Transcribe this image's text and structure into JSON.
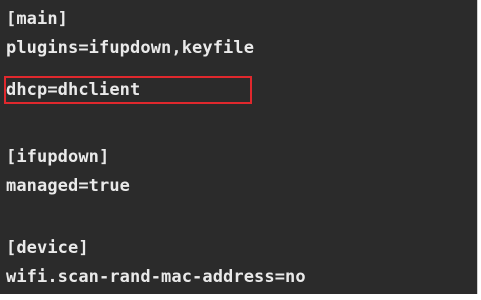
{
  "config_lines": [
    "[main]",
    "plugins=ifupdown,keyfile",
    "dhcp=dhclient",
    "",
    "[ifupdown]",
    "managed=true",
    "",
    "[device]",
    "wifi.scan-rand-mac-address=no"
  ],
  "highlight": {
    "line": "dhcp=dhclient",
    "color": "#e0282d"
  },
  "colors": {
    "background": "#2b2b2b",
    "text": "#eaeaea"
  }
}
